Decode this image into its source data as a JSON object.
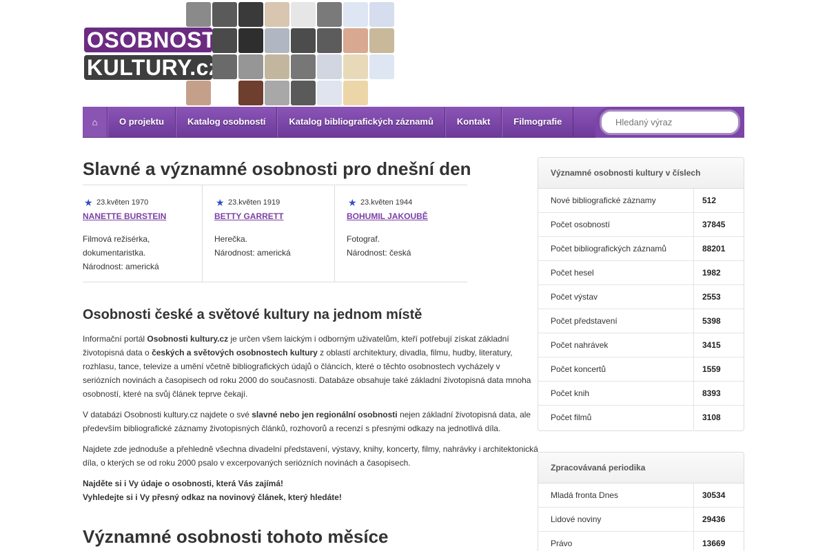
{
  "logo": {
    "line1": "OSOBNOSTI",
    "line2": "KULTURY.cz"
  },
  "nav": {
    "home_icon": "home-icon",
    "items": [
      "O projektu",
      "Katalog osobností",
      "Katalog bibliografických záznamů",
      "Kontakt",
      "Filmografie"
    ],
    "search_placeholder": "Hledaný výraz"
  },
  "main": {
    "title": "Slavné a významné osobnosti pro dnešní den",
    "today": [
      {
        "date": "23.květen 1970",
        "name": "NANETTE BURSTEIN",
        "desc1": "Filmová režisérka,",
        "desc2": "dokumentaristka.",
        "desc3": "Národnost: americká"
      },
      {
        "date": "23.květen 1919",
        "name": "BETTY GARRETT",
        "desc1": "Herečka.",
        "desc2": "Národnost: americká",
        "desc3": ""
      },
      {
        "date": "23.květen 1944",
        "name": "BOHUMIL JAKOUBĚ",
        "desc1": "Fotograf.",
        "desc2": "Národnost: česká",
        "desc3": ""
      }
    ],
    "subtitle": "Osobnosti české a světové kultury na jednom místě",
    "p1_a": "Informační portál ",
    "p1_b": "Osobnosti kultury.cz",
    "p1_c": " je určen všem laickým i odborným uživatelům, kteří potřebují získat základní životopisná data o ",
    "p1_d": "českých a světových osobnostech kultury",
    "p1_e": " z oblastí architektury, divadla, filmu, hudby, literatury, rozhlasu, tance, televize a umění včetně bibliografických údajů o článcích, které o těchto osobnostech vycházely v seriózních novinách a časopisech od roku 2000 do současnosti. Databáze obsahuje také základní životopisná data mnoha osobností, které na svůj článek teprve čekají.",
    "p2_a": "V databázi Osobnosti kultury.cz najdete o své ",
    "p2_b": "slavné nebo jen regionální osobnosti",
    "p2_c": " nejen základní životopisná data, ale především bibliografické záznamy životopisných článků, rozhovorů a recenzí s přesnými odkazy na jednotlivá díla.",
    "p3": "Najdete zde jednoduše a přehledně všechna divadelní představení, výstavy, knihy, koncerty, filmy, nahrávky i architektonická díla, o kterých se od roku 2000 psalo v excerpovaných seriózních novinách a časopisech.",
    "p4a": "Najděte si i Vy údaje o osobnosti, která Vás zajímá!",
    "p4b": "Vyhledejte si i Vy přesný odkaz na novinový článek, který hledáte!",
    "month_title": "Významné osobnosti tohoto měsíce"
  },
  "stats": {
    "title": "Významné osobnosti kultury v číslech",
    "rows": [
      {
        "label": "Nové bibliografické záznamy",
        "value": "512"
      },
      {
        "label": "Počet osobností",
        "value": "37845"
      },
      {
        "label": "Počet bibliografických záznamů",
        "value": "88201"
      },
      {
        "label": "Počet hesel",
        "value": "1982"
      },
      {
        "label": "Počet výstav",
        "value": "2553"
      },
      {
        "label": "Počet představení",
        "value": "5398"
      },
      {
        "label": "Počet nahrávek",
        "value": "3415"
      },
      {
        "label": "Počet koncertů",
        "value": "1559"
      },
      {
        "label": "Počet knih",
        "value": "8393"
      },
      {
        "label": "Počet filmů",
        "value": "3108"
      }
    ]
  },
  "periodika": {
    "title": "Zpracovávaná periodika",
    "rows": [
      {
        "label": "Mladá fronta Dnes",
        "value": "30534"
      },
      {
        "label": "Lidové noviny",
        "value": "29436"
      },
      {
        "label": "Právo",
        "value": "13669"
      }
    ]
  },
  "colors": {
    "accent": "#7b3fa6",
    "nav": "#7c45a8",
    "star": "#2f4fc9"
  }
}
